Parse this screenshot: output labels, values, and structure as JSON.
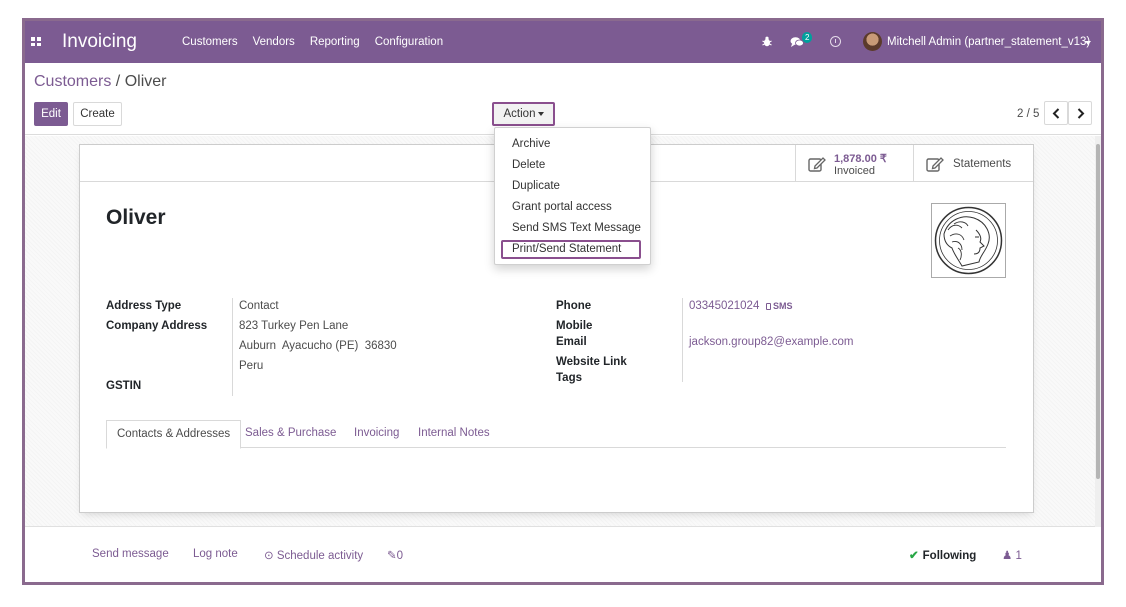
{
  "navbar": {
    "app_title": "Invoicing",
    "menu": [
      "Customers",
      "Vendors",
      "Reporting",
      "Configuration"
    ],
    "chat_badge": "2",
    "user": "Mitchell Admin (partner_statement_v13)"
  },
  "control_panel": {
    "breadcrumb_parent": "Customers",
    "breadcrumb_sep": " / ",
    "breadcrumb_current": "Oliver",
    "edit_label": "Edit",
    "create_label": "Create",
    "action_label": "Action",
    "pager": "2 / 5"
  },
  "action_menu": {
    "items": [
      "Archive",
      "Delete",
      "Duplicate",
      "Grant portal access",
      "Send SMS Text Message",
      "Print/Send Statement"
    ]
  },
  "button_box": {
    "invoiced_value": "1,878.00 ₹",
    "invoiced_label": "Invoiced",
    "statements_label": "Statements"
  },
  "partner": {
    "name": "Oliver",
    "address_type_label": "Address Type",
    "address_type": "Contact",
    "company_address_label": "Company Address",
    "street": "823 Turkey Pen Lane",
    "city_line": "Auburn  Ayacucho (PE)  36830",
    "country": "Peru",
    "gstin_label": "GSTIN",
    "phone_label": "Phone",
    "phone": "03345021024",
    "sms_label": "SMS",
    "mobile_label": "Mobile",
    "email_label": "Email",
    "email": "jackson.group82@example.com",
    "website_label": "Website Link",
    "tags_label": "Tags"
  },
  "tabs": [
    "Contacts & Addresses",
    "Sales & Purchase",
    "Invoicing",
    "Internal Notes"
  ],
  "chatter": {
    "send_message": "Send message",
    "log_note": "Log note",
    "schedule_activity": "Schedule activity",
    "attachments": "0",
    "following": "Following",
    "followers": "1"
  },
  "colors": {
    "brand": "#7c5b92",
    "highlight": "#8a4f8e"
  }
}
